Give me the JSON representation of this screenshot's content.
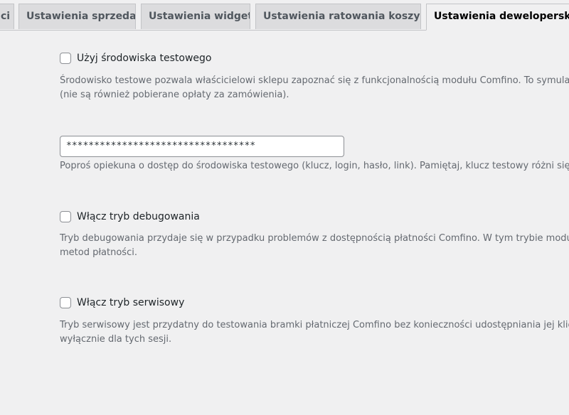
{
  "tabs": [
    {
      "label": "ci"
    },
    {
      "label": "Ustawienia sprzedaży"
    },
    {
      "label": "Ustawienia widgetu"
    },
    {
      "label": "Ustawienia ratowania koszyków"
    },
    {
      "label": "Ustawienia deweloperskie",
      "active": true
    }
  ],
  "settings": {
    "test_env": {
      "label": "Użyj środowiska testowego",
      "checked": false,
      "desc_line1": "Środowisko testowe pozwala właścicielowi sklepu zapoznać się z funkcjonalnością modułu Comfino. To symulator",
      "desc_line2": "(nie są również pobierane opłaty za zamówienia)."
    },
    "api_key": {
      "value": "**********************************",
      "desc": "Poproś opiekuna o dostęp do środowiska testowego (klucz, login, hasło, link). Pamiętaj, klucz testowy różni się od"
    },
    "debug": {
      "label": "Włącz tryb debugowania",
      "checked": false,
      "desc_line1": "Tryb debugowania przydaje się w przypadku problemów z dostępnością płatności Comfino. W tym trybie moduł re",
      "desc_line2": "metod płatności."
    },
    "service": {
      "label": "Włącz tryb serwisowy",
      "checked": false,
      "desc_line1": "Tryb serwisowy jest przydatny do testowania bramki płatniczej Comfino bez konieczności udostępniania jej kliento",
      "desc_line2": "wyłącznie dla tych sesji."
    }
  }
}
